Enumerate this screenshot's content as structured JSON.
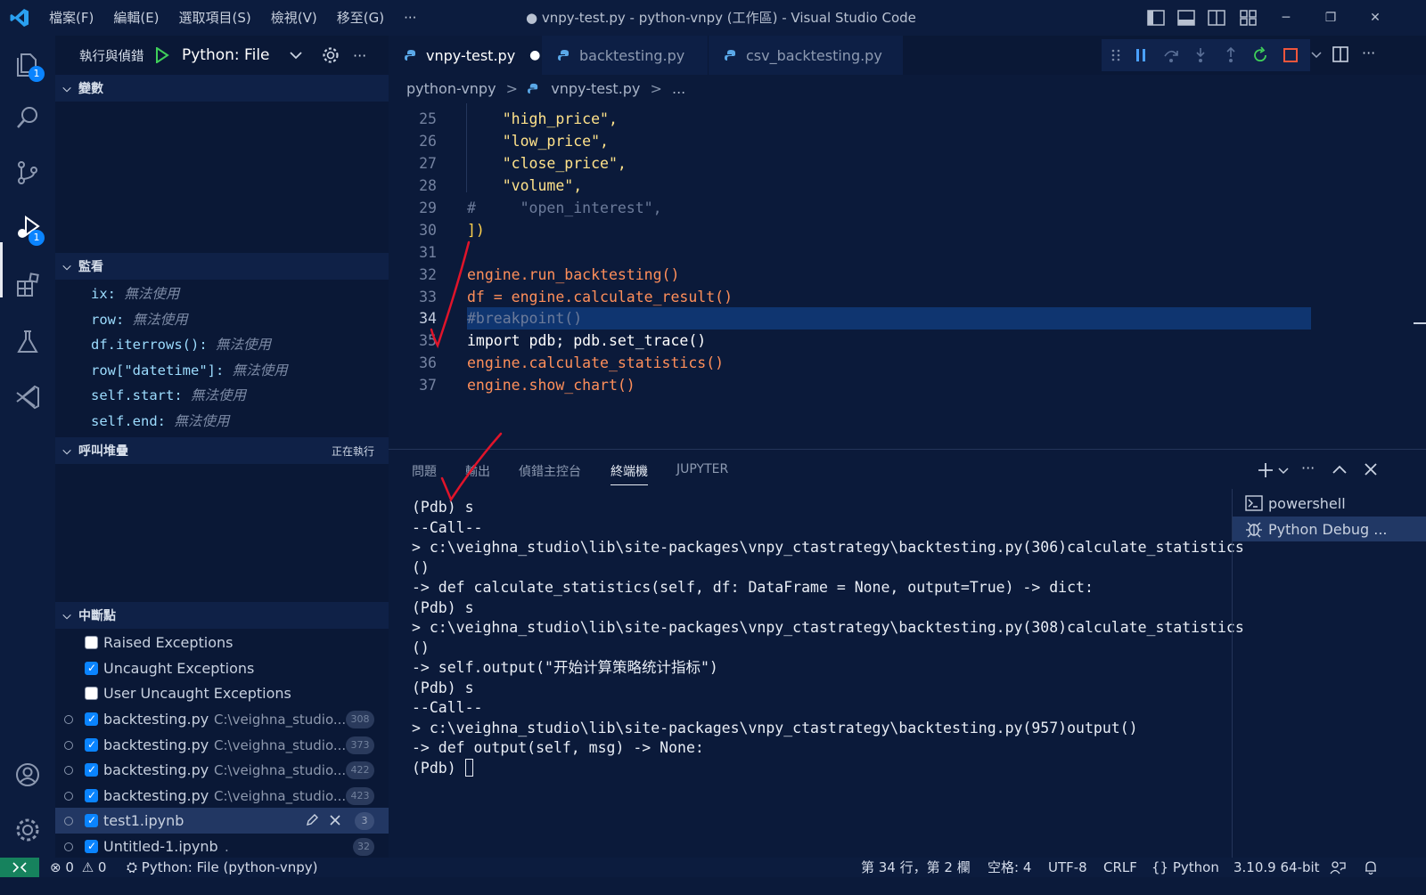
{
  "titlebar": {
    "menus": [
      "檔案(F)",
      "編輯(E)",
      "選取項目(S)",
      "檢視(V)",
      "移至(G)"
    ],
    "more": "···",
    "window_title": "● vnpy-test.py - python-vnpy (工作區) - Visual Studio Code"
  },
  "activity": {
    "explorer_badge": "1",
    "debug_badge": "1"
  },
  "sidebar": {
    "toolbar": {
      "title": "執行與偵錯",
      "config": "Python: File",
      "more": "···"
    },
    "variables": {
      "title": "變數"
    },
    "watch": {
      "title": "監看",
      "items": [
        {
          "expr": "ix:",
          "value": "無法使用"
        },
        {
          "expr": "row:",
          "value": "無法使用"
        },
        {
          "expr": "df.iterrows():",
          "value": "無法使用"
        },
        {
          "expr": "row[\"datetime\"]:",
          "value": "無法使用"
        },
        {
          "expr": "self.start:",
          "value": "無法使用"
        },
        {
          "expr": "self.end:",
          "value": "無法使用"
        }
      ]
    },
    "callstack": {
      "title": "呼叫堆疊",
      "status": "正在執行"
    },
    "breakpoints": {
      "title": "中斷點",
      "exceptions": [
        {
          "label": "Raised Exceptions",
          "checked": false
        },
        {
          "label": "Uncaught Exceptions",
          "checked": true
        },
        {
          "label": "User Uncaught Exceptions",
          "checked": false
        }
      ],
      "files": [
        {
          "name": "backtesting.py",
          "path": "C:\\veighna_studio...",
          "line": "308"
        },
        {
          "name": "backtesting.py",
          "path": "C:\\veighna_studio...",
          "line": "373"
        },
        {
          "name": "backtesting.py",
          "path": "C:\\veighna_studio...",
          "line": "422"
        },
        {
          "name": "backtesting.py",
          "path": "C:\\veighna_studio...",
          "line": "423"
        },
        {
          "name": "test1.ipynb",
          "path": "",
          "line": "3"
        },
        {
          "name": "Untitled-1.ipynb",
          "path": ".",
          "line": "32"
        }
      ]
    }
  },
  "tabs": [
    {
      "label": "vnpy-test.py",
      "dirty": "●"
    },
    {
      "label": "backtesting.py"
    },
    {
      "label": "csv_backtesting.py"
    }
  ],
  "breadcrumb": {
    "folder": "python-vnpy",
    "sep": ">",
    "file": "vnpy-test.py",
    "tail": "..."
  },
  "code": [
    {
      "n": "25",
      "text": "    \"high_price\","
    },
    {
      "n": "26",
      "text": "    \"low_price\","
    },
    {
      "n": "27",
      "text": "    \"close_price\","
    },
    {
      "n": "28",
      "text": "    \"volume\","
    },
    {
      "n": "29",
      "text": "#     \"open_interest\","
    },
    {
      "n": "30",
      "text": "])"
    },
    {
      "n": "31",
      "text": ""
    },
    {
      "n": "32",
      "text": "engine.run_backtesting()"
    },
    {
      "n": "33",
      "text": "df = engine.calculate_result()"
    },
    {
      "n": "34",
      "text": "#breakpoint()"
    },
    {
      "n": "35",
      "text": "import pdb; pdb.set_trace()"
    },
    {
      "n": "36",
      "text": "engine.calculate_statistics()"
    },
    {
      "n": "37",
      "text": "engine.show_chart()"
    }
  ],
  "panel": {
    "tabs": [
      "問題",
      "輸出",
      "偵錯主控台",
      "終端機",
      "JUPYTER"
    ],
    "active_tab": "終端機",
    "terminal_lines": [
      "(Pdb) s",
      "--Call--",
      "> c:\\veighna_studio\\lib\\site-packages\\vnpy_ctastrategy\\backtesting.py(306)calculate_statistics",
      "()",
      "-> def calculate_statistics(self, df: DataFrame = None, output=True) -> dict:",
      "(Pdb) s",
      "> c:\\veighna_studio\\lib\\site-packages\\vnpy_ctastrategy\\backtesting.py(308)calculate_statistics",
      "()",
      "-> self.output(\"开始计算策略统计指标\")",
      "(Pdb) s",
      "--Call--",
      "> c:\\veighna_studio\\lib\\site-packages\\vnpy_ctastrategy\\backtesting.py(957)output()",
      "-> def output(self, msg) -> None:",
      "(Pdb) "
    ],
    "terminals": [
      "powershell",
      "Python Debug ..."
    ]
  },
  "statusbar": {
    "errors": "0",
    "warnings": "0",
    "launch": "Python: File (python-vnpy)",
    "position": "第 34 行，第 2 欄",
    "spaces": "空格: 4",
    "encoding": "UTF-8",
    "eol": "CRLF",
    "language": "Python",
    "interpreter": "3.10.9 64-bit"
  },
  "colors": {
    "accent": "#0a84ff",
    "background": "#0b1a3a",
    "statusbar_remote": "#16825d",
    "annotation": "#e0142a"
  },
  "icons": [
    "vscode-logo-icon",
    "files-icon",
    "search-icon",
    "source-control-icon",
    "run-debug-icon",
    "extensions-icon",
    "testing-icon",
    "remote-explorer-icon",
    "account-icon",
    "settings-gear-icon",
    "python-file-icon",
    "play-icon",
    "gear-icon",
    "pause-icon",
    "step-over-icon",
    "step-into-icon",
    "step-out-icon",
    "restart-icon",
    "stop-icon",
    "terminal-icon",
    "debug-icon",
    "close-icon",
    "add-icon",
    "chevron-up-icon"
  ]
}
